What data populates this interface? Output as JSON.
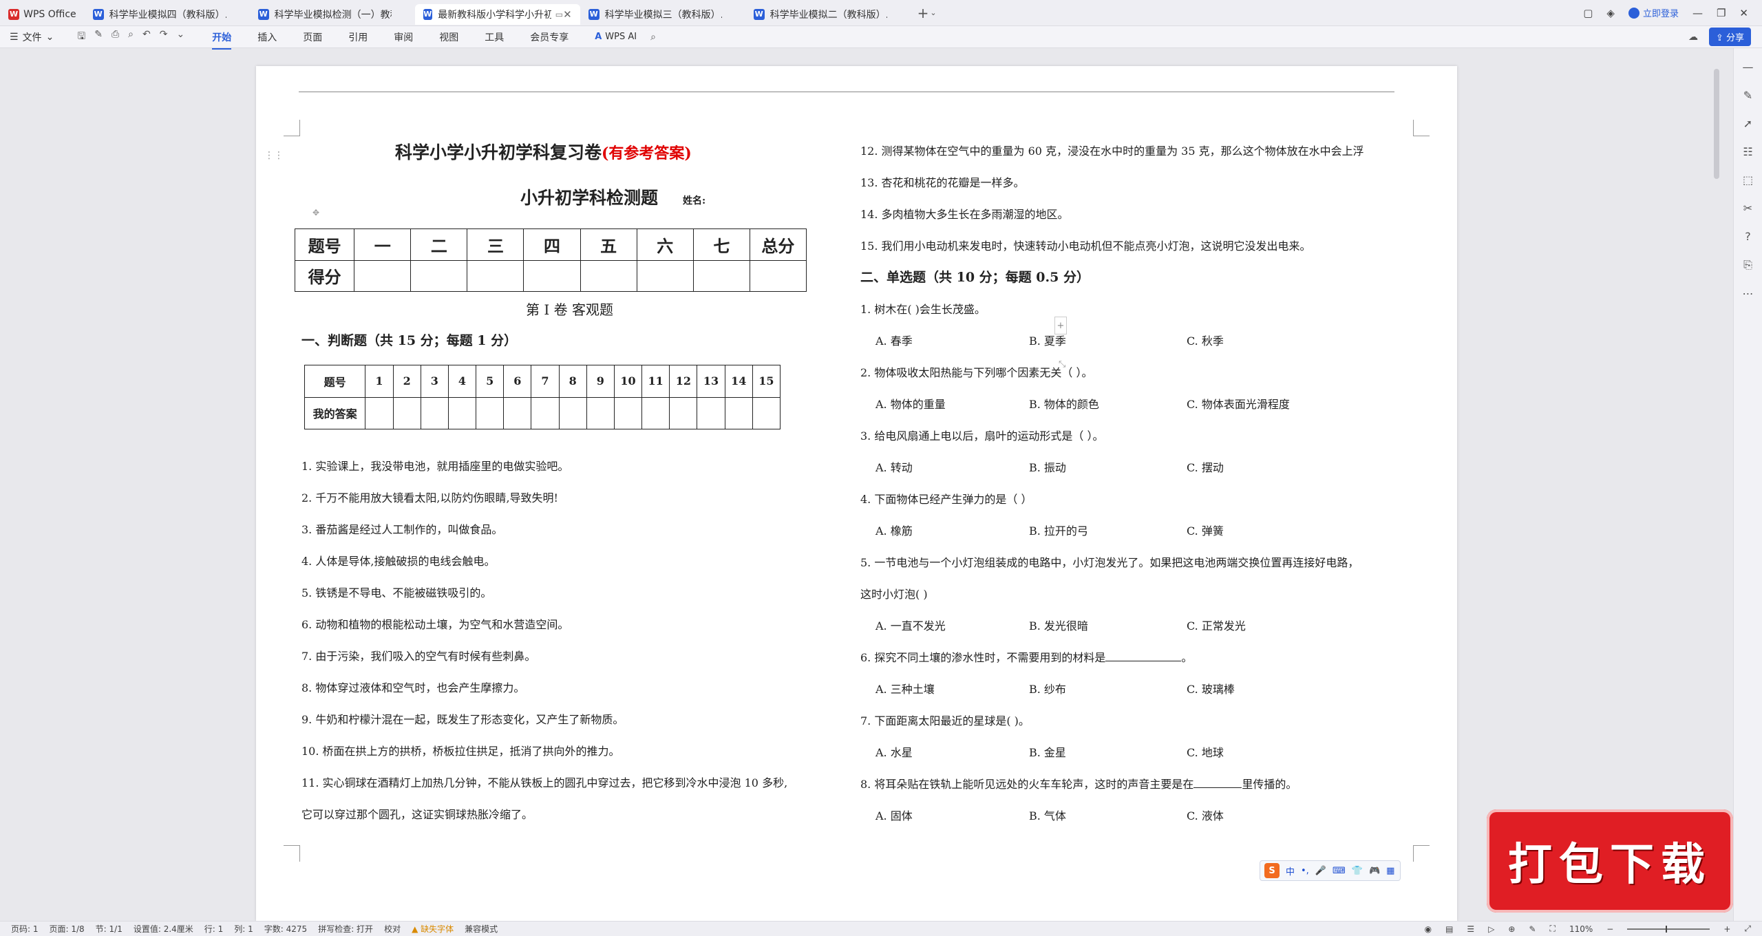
{
  "tabs": [
    {
      "label": "WPS Office",
      "type": "home"
    },
    {
      "label": "科学毕业模拟四（教科版）.doc",
      "type": "doc"
    },
    {
      "label": "科学毕业模拟检测（一）教科版.doc",
      "type": "doc"
    },
    {
      "label": "最新教科版小学科学小升初学科",
      "type": "doc",
      "active": true
    },
    {
      "label": "科学毕业模拟三（教科版）.doc",
      "type": "doc"
    },
    {
      "label": "科学毕业模拟二（教科版）.doc",
      "type": "doc"
    }
  ],
  "titlebar": {
    "login": "立即登录"
  },
  "ribbon": {
    "file": "文件",
    "menu": [
      "开始",
      "插入",
      "页面",
      "引用",
      "审阅",
      "视图",
      "工具",
      "会员专享"
    ],
    "active": "开始",
    "ai": "WPS AI",
    "share": "分享"
  },
  "doc": {
    "title_main": "科学小学小升初学科复习卷",
    "title_note": "(有参考答案)",
    "subtitle": "小升初学科检测题",
    "name_label": "姓名:",
    "score_table": {
      "headers": [
        "题号",
        "一",
        "二",
        "三",
        "四",
        "五",
        "六",
        "七",
        "总分"
      ],
      "row2": "得分"
    },
    "volume": "第 I 卷  客观题",
    "section1": "一、判断题（共 15 分；每题 1 分）",
    "answer_table": {
      "header": "题号",
      "numbers": [
        "1",
        "2",
        "3",
        "4",
        "5",
        "6",
        "7",
        "8",
        "9",
        "10",
        "11",
        "12",
        "13",
        "14",
        "15"
      ],
      "row2": "我的答案"
    },
    "judge_questions": [
      "1.  实验课上，我没带电池，就用插座里的电做实验吧。",
      "2.  千万不能用放大镜看太阳,以防灼伤眼睛,导致失明!",
      "3.  番茄酱是经过人工制作的，叫做食品。",
      "4.  人体是导体,接触破损的电线会触电。",
      "5.  铁锈是不导电、不能被磁铁吸引的。",
      "6.  动物和植物的根能松动土壤，为空气和水营造空间。",
      "7.  由于污染，我们吸入的空气有时候有些刺鼻。",
      "8.  物体穿过液体和空气时，也会产生摩擦力。",
      "9.  牛奶和柠檬汁混在一起，既发生了形态变化，又产生了新物质。",
      "10.  桥面在拱上方的拱桥，桥板拉住拱足，抵消了拱向外的推力。",
      "11.  实心铜球在酒精灯上加热几分钟，不能从铁板上的圆孔中穿过去，把它移到冷水中浸泡 10 多秒,",
      "它可以穿过那个圆孔，这证实铜球热胀冷缩了。",
      "12.  测得某物体在空气中的重量为 60 克，浸没在水中时的重量为 35 克，那么这个物体放在水中会上浮",
      "13.  杏花和桃花的花瓣是一样多。",
      "14.  多肉植物大多生长在多雨潮湿的地区。",
      "15.  我们用小电动机来发电时，快速转动小电动机但不能点亮小灯泡，这说明它没发出电来。"
    ],
    "section2": "二、单选题（共 10 分；每题 0.5 分）",
    "choice_questions": [
      {
        "q": "1.  树木在(      )会生长茂盛。",
        "a": "A.  春季",
        "b": "B.  夏季",
        "c": "C.  秋季"
      },
      {
        "q": "2.  物体吸收太阳热能与下列哪个因素无关（              ）。",
        "a": "A.  物体的重量",
        "b": "B.  物体的颜色",
        "c": "C.  物体表面光滑程度"
      },
      {
        "q": "3.  给电风扇通上电以后，扇叶的运动形式是（              ）。",
        "a": "A.  转动",
        "b": "B.  振动",
        "c": "C.  摆动"
      },
      {
        "q": "4.  下面物体已经产生弹力的是（        ）",
        "a": "A.  橡筋",
        "b": "B.  拉开的弓",
        "c": "C.  弹簧"
      },
      {
        "q": "5.  一节电池与一个小灯泡组装成的电路中，小灯泡发光了。如果把这电池两端交换位置再连接好电路，",
        "q2": "这时小灯泡(      )",
        "a": "A.  一直不发光",
        "b": "B.  发光很暗",
        "c": "C.  正常发光"
      },
      {
        "q": "6.  探究不同土壤的渗水性时，不需要用到的材料是",
        "q_tail": "。",
        "a": "A.  三种土壤",
        "b": "B.  纱布",
        "c": "C.  玻璃棒"
      },
      {
        "q": "7.  下面距离太阳最近的星球是(        )。",
        "a": "A.  水星",
        "b": "B.  金星",
        "c": "C.  地球"
      },
      {
        "q": "8.  将耳朵贴在铁轨上能听见远处的火车车轮声，这时的声音主要是在",
        "q_tail": "里传播的。",
        "a": "A.  固体",
        "b": "B.  气体",
        "c": "C.  液体"
      }
    ]
  },
  "ime": {
    "logo": "S",
    "mode": "中"
  },
  "watermark": "打包下载",
  "status": {
    "page": "页码: 1",
    "pages": "页面: 1/8",
    "section": "节: 1/1",
    "setting": "设置值: 2.4厘米",
    "row": "行: 1",
    "col": "列: 1",
    "words": "字数: 4275",
    "spell": "拼写检查: 打开",
    "proof": "校对",
    "font_missing": "缺失字体",
    "compat": "兼容模式",
    "zoom": "110%"
  }
}
